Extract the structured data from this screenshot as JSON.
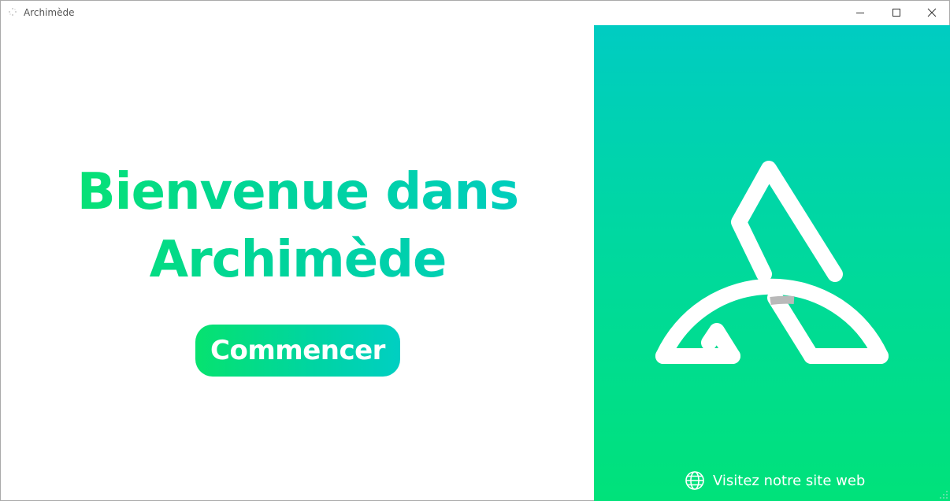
{
  "window": {
    "title": "Archimède",
    "controls": {
      "minimize_icon": "minimize-icon",
      "maximize_icon": "maximize-icon",
      "close_icon": "close-icon"
    }
  },
  "welcome": {
    "title_line1": "Bienvenue dans",
    "title_line2": "Archimède",
    "start_button_label": "Commencer"
  },
  "side_panel": {
    "logo_icon": "archimede-logo-icon",
    "website_icon": "globe-icon",
    "website_label": "Visitez notre site web"
  },
  "colors": {
    "accent_green": "#08e46d",
    "accent_teal": "#00ccc4",
    "panel_top": "#00ccc2",
    "panel_bottom": "#00e27a",
    "title_text": "#555555"
  }
}
